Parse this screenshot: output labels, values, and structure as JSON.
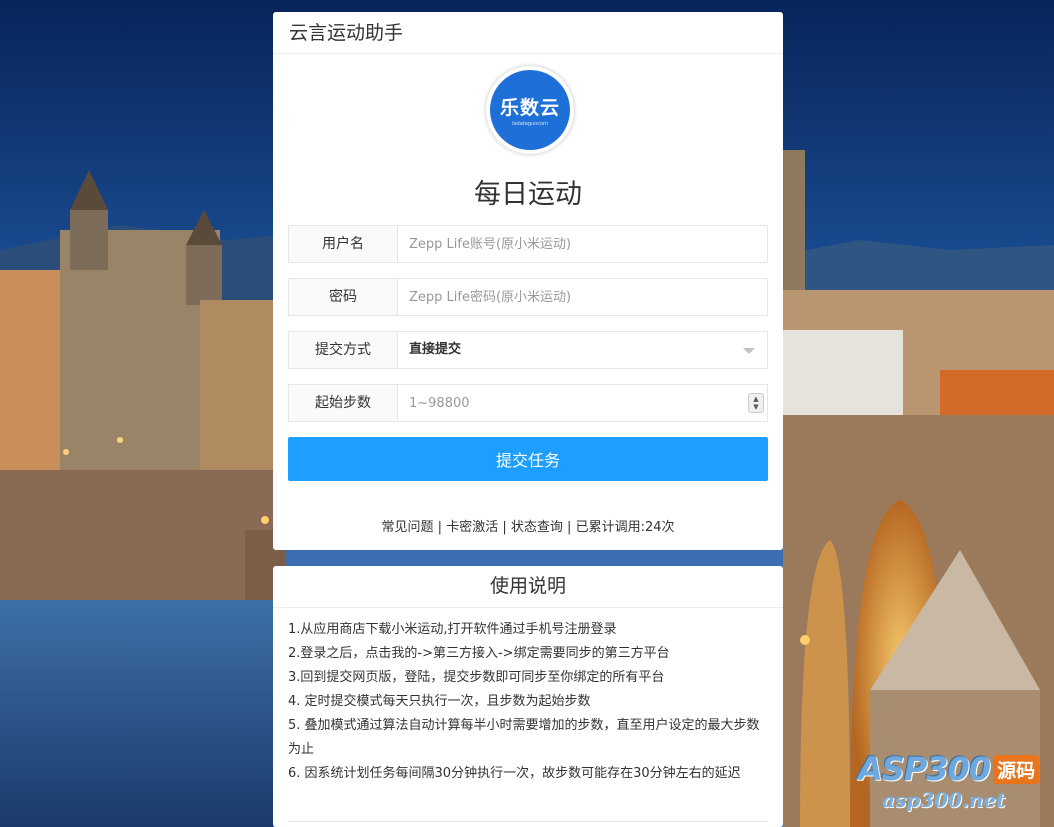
{
  "header": {
    "title": "云言运动助手"
  },
  "logo": {
    "text": "乐数云",
    "sub": "ledataguocom"
  },
  "main_title": "每日运动",
  "form": {
    "username_label": "用户名",
    "username_placeholder": "Zepp Life账号(原小米运动)",
    "password_label": "密码",
    "password_placeholder": "Zepp Life密码(原小米运动)",
    "mode_label": "提交方式",
    "mode_value": "直接提交",
    "steps_label": "起始步数",
    "steps_placeholder": "1~98800",
    "submit_label": "提交任务"
  },
  "links": {
    "faq": "常见问题",
    "activate": "卡密激活",
    "status": "状态查询",
    "calls": "已累计调用:24次",
    "sep": "|"
  },
  "help": {
    "title": "使用说明",
    "items": [
      "1.从应用商店下载小米运动,打开软件通过手机号注册登录",
      "2.登录之后，点击我的->第三方接入->绑定需要同步的第三方平台",
      "3.回到提交网页版，登陆，提交步数即可同步至你绑定的所有平台",
      "4. 定时提交模式每天只执行一次，且步数为起始步数",
      "5. 叠加模式通过算法自动计算每半小时需要增加的步数，直至用户设定的最大步数为止",
      "6. 因系统计划任务每间隔30分钟执行一次，故步数可能存在30分钟左右的延迟"
    ]
  },
  "watermark": {
    "brand": "ASP300",
    "badge": "源码",
    "url": "asp300.net"
  },
  "colors": {
    "primary_button": "#1e9fff",
    "logo_blue": "#1f6fd8"
  }
}
